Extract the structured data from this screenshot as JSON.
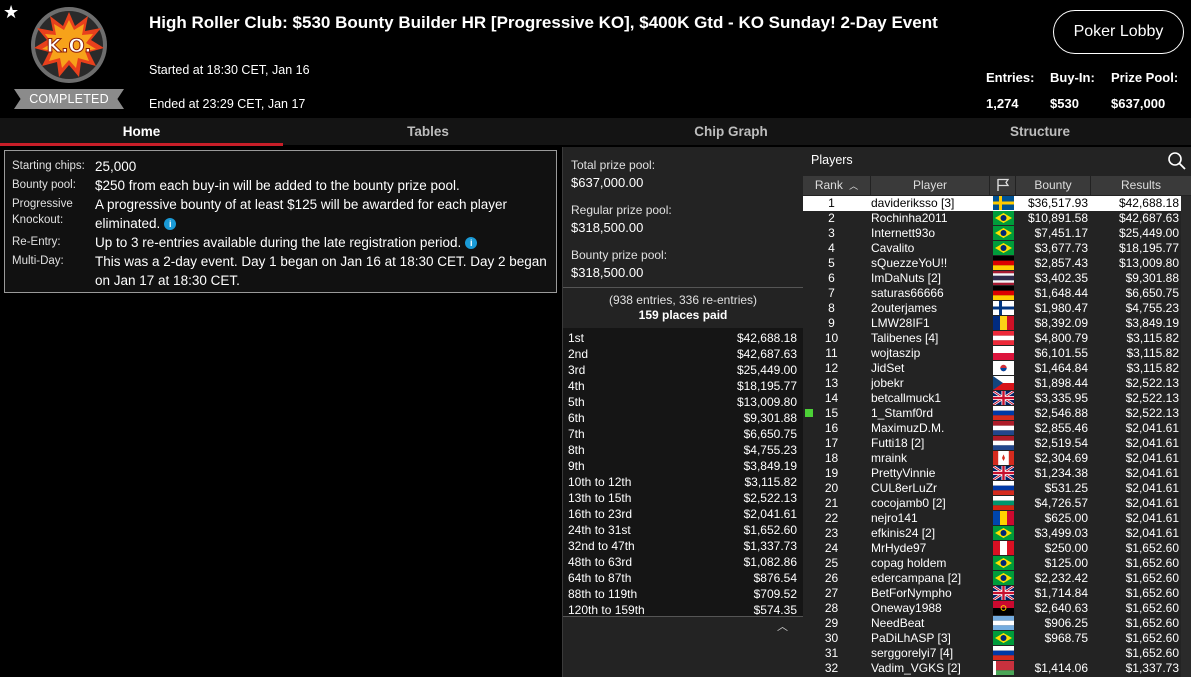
{
  "header": {
    "logo_text": "K.O.",
    "status_badge": "COMPLETED",
    "title": "High Roller Club: $530 Bounty Builder HR [Progressive KO],  $400K Gtd - KO Sunday! 2-Day Event",
    "started": "Started at 18:30 CET, Jan 16",
    "ended": "Ended at 23:29 CET, Jan 17",
    "lobby_button": "Poker Lobby",
    "stats": {
      "entries_label": "Entries:",
      "entries_value": "1,274",
      "buyin_label": "Buy-In:",
      "buyin_value": "$530",
      "prizepool_label": "Prize Pool:",
      "prizepool_value": "$637,000"
    }
  },
  "tabs": [
    {
      "label": "Home",
      "active": true
    },
    {
      "label": "Tables",
      "active": false
    },
    {
      "label": "Chip Graph",
      "active": false
    },
    {
      "label": "Structure",
      "active": false
    }
  ],
  "info": [
    {
      "label": "Starting chips:",
      "value": "25,000",
      "info": false
    },
    {
      "label": "Bounty pool:",
      "value": "$250 from each buy-in will be added to the bounty prize pool.",
      "info": false
    },
    {
      "label": "Progressive Knockout:",
      "value": "A progressive bounty of at least $125 will be awarded for each player eliminated.",
      "info": true
    },
    {
      "label": "Re-Entry:",
      "value": "Up to 3 re-entries available during the late registration period.",
      "info": true
    },
    {
      "label": "Multi-Day:",
      "value": "This was a 2-day event. Day 1 began on Jan 16 at 18:30 CET. Day 2 began on Jan 17 at 18:30 CET.",
      "info": false
    }
  ],
  "prize": {
    "total_label": "Total prize pool:",
    "total_value": "$637,000.00",
    "regular_label": "Regular prize pool:",
    "regular_value": "$318,500.00",
    "bounty_label": "Bounty prize pool:",
    "bounty_value": "$318,500.00",
    "entries_text": "(938 entries, 336 re-entries)",
    "places_paid": "159 places paid",
    "payouts": [
      {
        "place": "1st",
        "amount": "$42,688.18"
      },
      {
        "place": "2nd",
        "amount": "$42,687.63"
      },
      {
        "place": "3rd",
        "amount": "$25,449.00"
      },
      {
        "place": "4th",
        "amount": "$18,195.77"
      },
      {
        "place": "5th",
        "amount": "$13,009.80"
      },
      {
        "place": "6th",
        "amount": "$9,301.88"
      },
      {
        "place": "7th",
        "amount": "$6,650.75"
      },
      {
        "place": "8th",
        "amount": "$4,755.23"
      },
      {
        "place": "9th",
        "amount": "$3,849.19"
      },
      {
        "place": "10th to 12th",
        "amount": "$3,115.82"
      },
      {
        "place": "13th to 15th",
        "amount": "$2,522.13"
      },
      {
        "place": "16th to 23rd",
        "amount": "$2,041.61"
      },
      {
        "place": "24th to 31st",
        "amount": "$1,652.60"
      },
      {
        "place": "32nd to 47th",
        "amount": "$1,337.73"
      },
      {
        "place": "48th to 63rd",
        "amount": "$1,082.86"
      },
      {
        "place": "64th to 87th",
        "amount": "$876.54"
      },
      {
        "place": "88th to 119th",
        "amount": "$709.52"
      },
      {
        "place": "120th to 159th",
        "amount": "$574.35"
      }
    ]
  },
  "players": {
    "title": "Players",
    "columns": {
      "rank": "Rank",
      "player": "Player",
      "bounty": "Bounty",
      "results": "Results"
    },
    "rows": [
      {
        "rank": "1",
        "name": "davideriksso [3]",
        "flag": "se",
        "bounty": "$36,517.93",
        "result": "$42,688.18",
        "selected": true
      },
      {
        "rank": "2",
        "name": "Rochinha2011",
        "flag": "br",
        "bounty": "$10,891.58",
        "result": "$42,687.63"
      },
      {
        "rank": "3",
        "name": "Internett93o",
        "flag": "br",
        "bounty": "$7,451.17",
        "result": "$25,449.00"
      },
      {
        "rank": "4",
        "name": "Cavalito",
        "flag": "br",
        "bounty": "$3,677.73",
        "result": "$18,195.77"
      },
      {
        "rank": "5",
        "name": "sQuezzeYoU!!",
        "flag": "de",
        "bounty": "$2,857.43",
        "result": "$13,009.80"
      },
      {
        "rank": "6",
        "name": "ImDaNuts [2]",
        "flag": "th",
        "bounty": "$3,402.35",
        "result": "$9,301.88"
      },
      {
        "rank": "7",
        "name": "saturas66666",
        "flag": "de",
        "bounty": "$1,648.44",
        "result": "$6,650.75"
      },
      {
        "rank": "8",
        "name": "2outerjames",
        "flag": "fi",
        "bounty": "$1,980.47",
        "result": "$4,755.23"
      },
      {
        "rank": "9",
        "name": "LMW28IF1",
        "flag": "ro",
        "bounty": "$8,392.09",
        "result": "$3,849.19"
      },
      {
        "rank": "10",
        "name": "Talibenes [4]",
        "flag": "at",
        "bounty": "$4,800.79",
        "result": "$3,115.82"
      },
      {
        "rank": "11",
        "name": "wojtaszip",
        "flag": "pl",
        "bounty": "$6,101.55",
        "result": "$3,115.82"
      },
      {
        "rank": "12",
        "name": "JidSet",
        "flag": "kr",
        "bounty": "$1,464.84",
        "result": "$3,115.82"
      },
      {
        "rank": "13",
        "name": "jobekr",
        "flag": "cz",
        "bounty": "$1,898.44",
        "result": "$2,522.13"
      },
      {
        "rank": "14",
        "name": "betcallmuck1",
        "flag": "gb",
        "bounty": "$3,335.95",
        "result": "$2,522.13"
      },
      {
        "rank": "15",
        "name": "1_Stamf0rd",
        "flag": "ru",
        "bounty": "$2,546.88",
        "result": "$2,522.13",
        "highlight": true
      },
      {
        "rank": "16",
        "name": "MaximuzD.M.",
        "flag": "nl",
        "bounty": "$2,855.46",
        "result": "$2,041.61"
      },
      {
        "rank": "17",
        "name": "Futti18 [2]",
        "flag": "nl",
        "bounty": "$2,519.54",
        "result": "$2,041.61"
      },
      {
        "rank": "18",
        "name": "mraink",
        "flag": "ca",
        "bounty": "$2,304.69",
        "result": "$2,041.61"
      },
      {
        "rank": "19",
        "name": "PrettyVinnie",
        "flag": "gb",
        "bounty": "$1,234.38",
        "result": "$2,041.61"
      },
      {
        "rank": "20",
        "name": "CUL8erLuZr",
        "flag": "ru",
        "bounty": "$531.25",
        "result": "$2,041.61"
      },
      {
        "rank": "21",
        "name": "cocojamb0 [2]",
        "flag": "bg",
        "bounty": "$4,726.57",
        "result": "$2,041.61"
      },
      {
        "rank": "22",
        "name": "nejro141",
        "flag": "md",
        "bounty": "$625.00",
        "result": "$2,041.61"
      },
      {
        "rank": "23",
        "name": "efkinis24 [2]",
        "flag": "br",
        "bounty": "$3,499.03",
        "result": "$2,041.61"
      },
      {
        "rank": "24",
        "name": "MrHyde97",
        "flag": "pe",
        "bounty": "$250.00",
        "result": "$1,652.60"
      },
      {
        "rank": "25",
        "name": "copag holdem",
        "flag": "br",
        "bounty": "$125.00",
        "result": "$1,652.60"
      },
      {
        "rank": "26",
        "name": "edercampana [2]",
        "flag": "br",
        "bounty": "$2,232.42",
        "result": "$1,652.60"
      },
      {
        "rank": "27",
        "name": "BetForNympho",
        "flag": "gb",
        "bounty": "$1,714.84",
        "result": "$1,652.60"
      },
      {
        "rank": "28",
        "name": "Oneway1988",
        "flag": "ao",
        "bounty": "$2,640.63",
        "result": "$1,652.60"
      },
      {
        "rank": "29",
        "name": "NeedBeat",
        "flag": "ar",
        "bounty": "$906.25",
        "result": "$1,652.60"
      },
      {
        "rank": "30",
        "name": "PaDiLhASP [3]",
        "flag": "br",
        "bounty": "$968.75",
        "result": "$1,652.60"
      },
      {
        "rank": "31",
        "name": "serggorelyi7 [4]",
        "flag": "ru",
        "bounty": "",
        "result": "$1,652.60"
      },
      {
        "rank": "32",
        "name": "Vadim_VGKS [2]",
        "flag": "by",
        "bounty": "$1,414.06",
        "result": "$1,337.73"
      }
    ]
  }
}
